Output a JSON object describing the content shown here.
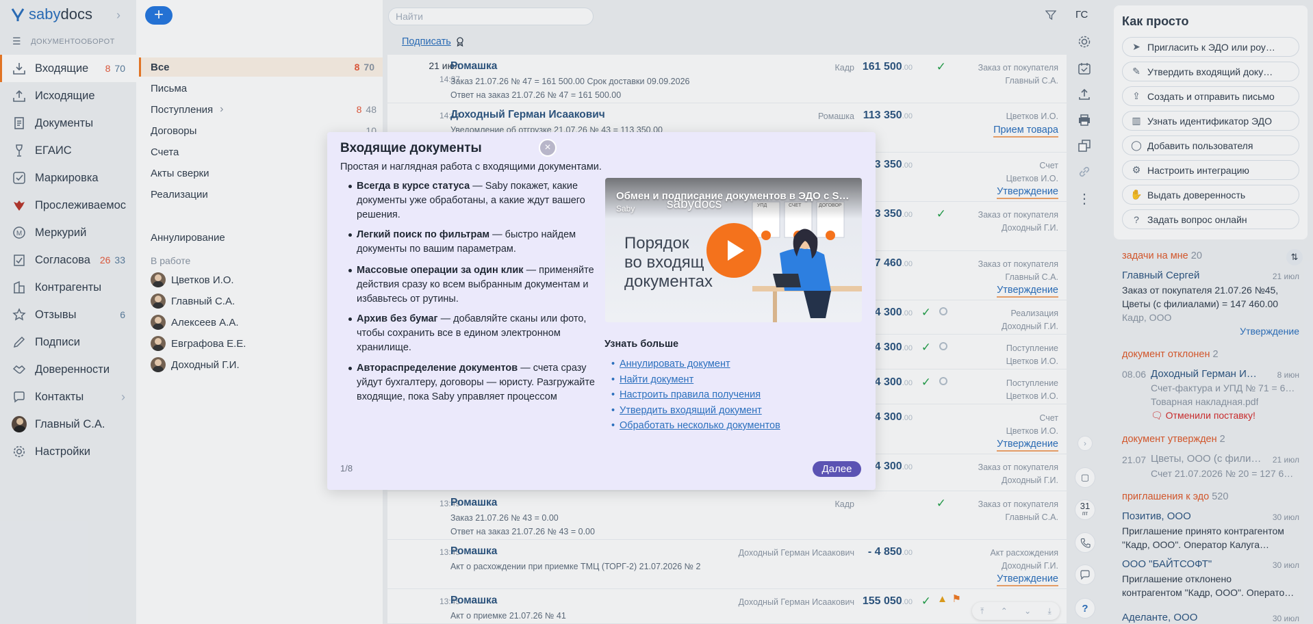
{
  "brand": {
    "logo_a": "saby",
    "logo_b": "docs",
    "section": "ДОКУМЕНТООБОРОТ"
  },
  "nav": {
    "items": [
      {
        "label": "Входящие",
        "red": "8",
        "count": "70",
        "icon": "inbox-icon"
      },
      {
        "label": "Исходящие",
        "red": "",
        "count": "",
        "icon": "outbox-icon"
      },
      {
        "label": "Документы",
        "red": "",
        "count": "",
        "icon": "documents-icon"
      },
      {
        "label": "ЕГАИС",
        "red": "",
        "count": "",
        "icon": "wine-glass-icon"
      },
      {
        "label": "Маркировка",
        "red": "",
        "count": "",
        "icon": "marking-icon"
      },
      {
        "label": "Прослеживаемос",
        "red": "",
        "count": "",
        "icon": "eagle-icon"
      },
      {
        "label": "Меркурий",
        "red": "",
        "count": "",
        "icon": "mercury-icon"
      },
      {
        "label": "Согласова",
        "red": "26",
        "count": "33",
        "icon": "approval-icon"
      },
      {
        "label": "Контрагенты",
        "red": "",
        "count": "",
        "icon": "contractors-icon"
      },
      {
        "label": "Отзывы",
        "red": "",
        "count": "6",
        "icon": "star-icon"
      },
      {
        "label": "Подписи",
        "red": "",
        "count": "",
        "icon": "signature-icon"
      },
      {
        "label": "Доверенности",
        "red": "",
        "count": "",
        "icon": "handshake-icon"
      },
      {
        "label": "Контакты",
        "red": "",
        "count": "",
        "icon": "chat-icon"
      },
      {
        "label": "Главный С.А.",
        "red": "",
        "count": "",
        "icon": "user-avatar"
      },
      {
        "label": "Настройки",
        "red": "",
        "count": "",
        "icon": "gear-icon"
      }
    ]
  },
  "folders": {
    "all": {
      "label": "Все",
      "red": "8",
      "count": "70"
    },
    "items": [
      {
        "label": "Письма",
        "red": "",
        "count": ""
      },
      {
        "label": "Поступления",
        "red": "8",
        "count": "48"
      },
      {
        "label": "Договоры",
        "red": "",
        "count": "10"
      },
      {
        "label": "Счета",
        "red": "",
        "count": ""
      },
      {
        "label": "Акты сверки",
        "red": "",
        "count": ""
      },
      {
        "label": "Реализации",
        "red": "",
        "count": ""
      }
    ],
    "cancel": "Аннулирование",
    "in_work": "В работе",
    "people": [
      "Цветков И.О.",
      "Главный С.А.",
      "Алексеев А.А.",
      "Евграфова Е.Е.",
      "Доходный Г.И."
    ]
  },
  "search": {
    "placeholder": "Найти"
  },
  "toolbar": {
    "sign": "Подписать",
    "gc": "ГС"
  },
  "rows": [
    {
      "date": "21 июл",
      "time": "14:37",
      "who": "Ромашка",
      "l1": "Заказ 21.07.26 № 47 = 161 500.00 Срок доставки 09.09.2026",
      "l2": "Ответ на заказ 21.07.26 № 47 = 161 500.00",
      "org": "Кадр",
      "sum": "161 500",
      "kop": ".00",
      "check": "✓",
      "t1": "Заказ от покупателя",
      "t2": "Главный С.А.",
      "status": ""
    },
    {
      "date": "",
      "time": "14:14",
      "who": "Доходный Герман Исаакович",
      "l1": "Уведомление об отгрузке 21.07.26 № 43 = 113 350.00",
      "l2": "",
      "org": "Ромашка",
      "sum": "113 350",
      "kop": ".00",
      "check": "",
      "t1": "",
      "t2": "Цветков И.О.",
      "status": "Прием товара"
    },
    {
      "date": "",
      "time": "",
      "who": "",
      "l1": "",
      "l2": "",
      "org": "",
      "sum": "3 350",
      "kop": ".00",
      "check": "",
      "t1": "Счет",
      "t2": "Цветков И.О.",
      "status": "Утверждение"
    },
    {
      "date": "",
      "time": "",
      "who": "",
      "l1": "",
      "l2": "",
      "org": "",
      "sum": "3 350",
      "kop": ".00",
      "check": "✓",
      "t1": "Заказ от покупателя",
      "t2": "Доходный Г.И.",
      "status": ""
    },
    {
      "date": "",
      "time": "",
      "who": "",
      "l1": "",
      "l2": "",
      "org": "",
      "sum": "7 460",
      "kop": ".00",
      "check": "",
      "t1": "Заказ от покупателя",
      "t2": "Главный С.А.",
      "status": "Утверждение"
    },
    {
      "date": "",
      "time": "",
      "who": "",
      "l1": "",
      "l2": "",
      "org": "",
      "sum": "4 300",
      "kop": ".00",
      "check": "✓",
      "t1": "Реализация",
      "t2": "Доходный Г.И.",
      "status": ""
    },
    {
      "date": "",
      "time": "",
      "who": "",
      "l1": "",
      "l2": "",
      "org": "",
      "sum": "4 300",
      "kop": ".00",
      "check": "✓",
      "t1": "Поступление",
      "t2": "Цветков И.О.",
      "status": ""
    },
    {
      "date": "",
      "time": "",
      "who": "",
      "l1": "",
      "l2": "",
      "org": "",
      "sum": "4 300",
      "kop": ".00",
      "check": "✓",
      "t1": "Поступление",
      "t2": "Цветков И.О.",
      "status": ""
    },
    {
      "date": "",
      "time": "",
      "who": "",
      "l1": "",
      "l2": "",
      "org": "",
      "sum": "4 300",
      "kop": ".00",
      "check": "",
      "t1": "Счет",
      "t2": "Цветков И.О.",
      "status": "Утверждение"
    },
    {
      "date": "",
      "time": "",
      "who": "",
      "l1": "",
      "l2": "",
      "org": "",
      "sum": "4 300",
      "kop": ".00",
      "check": "",
      "t1": "Заказ от покупателя",
      "t2": "Доходный Г.И.",
      "status": ""
    },
    {
      "date": "",
      "time": "13:49",
      "who": "Ромашка",
      "l1": "Заказ 21.07.26 № 43 = 0.00",
      "l2": "Ответ на заказ 21.07.26 № 43 = 0.00",
      "org": "Кадр",
      "sum": "",
      "kop": "",
      "check": "✓",
      "t1": "Заказ от покупателя",
      "t2": "Главный С.А.",
      "status": ""
    },
    {
      "date": "",
      "time": "13:45",
      "who": "Ромашка",
      "l1": "Акт о расхождении при приемке ТМЦ (ТОРГ-2) 21.07.2026 № 2",
      "l2": "",
      "org": "Доходный Герман Исаакович",
      "sum": "- 4 850",
      "kop": ".00",
      "check": "",
      "t1": "Акт расхождения",
      "t2": "Доходный Г.И.",
      "status": "Утверждение"
    },
    {
      "date": "",
      "time": "13:45",
      "who": "Ромашка",
      "l1": "Акт о приемке 21.07.26 № 41",
      "l2": "",
      "org": "Доходный Герман Исаакович",
      "sum": "155 050",
      "kop": ".00",
      "check": "✓",
      "t1": "",
      "t2": "",
      "status": ""
    }
  ],
  "how": {
    "title": "Как просто",
    "items": [
      {
        "label": "Пригласить к ЭДО или роу…",
        "icon": "paper-plane-icon"
      },
      {
        "label": "Утвердить входящий доку…",
        "icon": "stamp-icon"
      },
      {
        "label": "Создать и отправить письмо",
        "icon": "upload-icon"
      },
      {
        "label": "Узнать идентификатор ЭДО",
        "icon": "building-icon"
      },
      {
        "label": "Добавить пользователя",
        "icon": "user-icon"
      },
      {
        "label": "Настроить интеграцию",
        "icon": "integration-icon"
      },
      {
        "label": "Выдать доверенность",
        "icon": "handshake-icon"
      },
      {
        "label": "Задать вопрос онлайн",
        "icon": "question-icon"
      }
    ]
  },
  "feed": {
    "tasks_h": "задачи на мне",
    "tasks_n": "20",
    "task": {
      "name": "Главный Сергей",
      "date": "21 июл",
      "l1": "Заказ от покупателя 21.07.26 №45,",
      "l2": "Цветы (с филиалами) = 147 460.00",
      "l3": "Кадр, ООО",
      "status": "Утверждение"
    },
    "rejected_h": "документ отклонен",
    "rejected_n": "2",
    "rejected": {
      "d": "08.06",
      "name": "Доходный Герман И…",
      "date": "8 июн",
      "l1": "Счет-фактура и УПД № 71 = 6…",
      "l2": "Товарная накладная.pdf",
      "reason": "Отменили поставку!"
    },
    "approved_h": "документ утвержден",
    "approved_n": "2",
    "approved": {
      "d": "21.07",
      "name": "Цветы, ООО (с фили…",
      "date": "21 июл",
      "l1": "Счет 21.07.2026 № 20 = 127 6…"
    },
    "inv_h": "приглашения к эдо",
    "inv_n": "520",
    "inv1": {
      "name": "Позитив, ООО",
      "date": "30 июл",
      "l1": "Приглашение принято контрагентом",
      "l2": "\"Кадр, ООО\". Оператор Калуга…"
    },
    "inv2": {
      "name": "ООО \"БАЙТСОФТ\"",
      "date": "30 июл",
      "l1": "Приглашение отклонено",
      "l2": "контрагентом \"Кадр, ООО\". Операто…"
    },
    "inv3": {
      "name": "Аделанте, ООО",
      "date": "30 июл"
    }
  },
  "modal": {
    "title": "Входящие документы",
    "subtitle": "Простая и наглядная работа с входящими документами.",
    "bullets": [
      {
        "b": "Всегда в курсе статуса",
        "t": " — Saby покажет, какие документы уже обработаны, а какие ждут вашего решения."
      },
      {
        "b": "Легкий поиск по фильтрам",
        "t": " — быстро найдем документы по вашим параметрам."
      },
      {
        "b": "Массовые операции за один клик",
        "t": " — применяйте действия сразу ко всем выбранным документам и избавьтесь от рутины."
      },
      {
        "b": "Архив без бумаг",
        "t": " — добавляйте сканы или фото, чтобы сохранить все в едином электронном хранилище."
      },
      {
        "b": "Автораспределение документов",
        "t": " — счета сразу уйдут бухгалтеру, договоры — юристу. Разгружайте входящие, пока Saby управляет процессом"
      }
    ],
    "video": {
      "title": "Обмен и подписание документов в ЭДО с S…",
      "channel": "Saby",
      "logo": "sabydocs",
      "big1": "Порядок",
      "big2": "во входящ",
      "big3": "документах",
      "tag1": "УПД",
      "tag2": "СЧЕТ",
      "tag3": "ДОГОВОР"
    },
    "learn_title": "Узнать больше",
    "links": [
      "Аннулировать документ",
      "Найти документ",
      "Настроить правила получения",
      "Утвердить входящий документ",
      "Обработать несколько документов"
    ],
    "pager": "1/8",
    "next": "Далее",
    "close": "×"
  },
  "calendar": {
    "day": "31",
    "wd": "пт"
  }
}
